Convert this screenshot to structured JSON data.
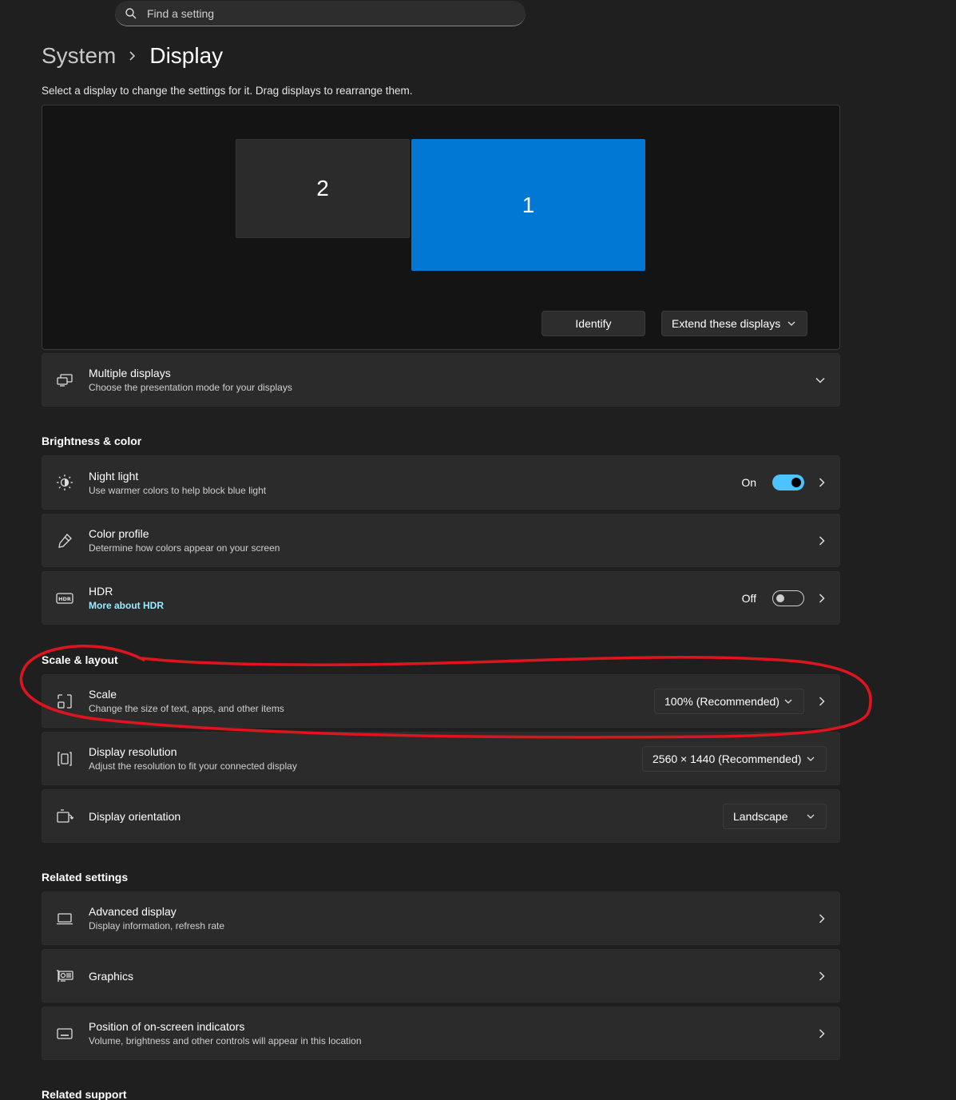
{
  "search": {
    "placeholder": "Find a setting"
  },
  "breadcrumb": {
    "parent": "System",
    "current": "Display"
  },
  "instructions": "Select a display to change the settings for it. Drag displays to rearrange them.",
  "monitors": [
    {
      "label": "2"
    },
    {
      "label": "1"
    }
  ],
  "arrange_buttons": {
    "identify": "Identify",
    "extend": "Extend these displays"
  },
  "multiple_displays": {
    "title": "Multiple displays",
    "subtitle": "Choose the presentation mode for your displays"
  },
  "sections": {
    "brightness": "Brightness & color",
    "scale_layout": "Scale & layout",
    "related_settings": "Related settings",
    "related_support": "Related support"
  },
  "night_light": {
    "title": "Night light",
    "subtitle": "Use warmer colors to help block blue light",
    "state": "On"
  },
  "color_profile": {
    "title": "Color profile",
    "subtitle": "Determine how colors appear on your screen"
  },
  "hdr": {
    "title": "HDR",
    "link": "More about HDR",
    "state": "Off"
  },
  "scale": {
    "title": "Scale",
    "subtitle": "Change the size of text, apps, and other items",
    "value": "100% (Recommended)"
  },
  "resolution": {
    "title": "Display resolution",
    "subtitle": "Adjust the resolution to fit your connected display",
    "value": "2560 × 1440 (Recommended)"
  },
  "orientation": {
    "title": "Display orientation",
    "value": "Landscape"
  },
  "advanced_display": {
    "title": "Advanced display",
    "subtitle": "Display information, refresh rate"
  },
  "graphics": {
    "title": "Graphics"
  },
  "osd_position": {
    "title": "Position of on-screen indicators",
    "subtitle": "Volume, brightness and other controls will appear in this location"
  },
  "colors": {
    "accent": "#0078d4",
    "toggle_on": "#4cc2ff",
    "link": "#99ebff",
    "annotation": "#e0141e"
  }
}
